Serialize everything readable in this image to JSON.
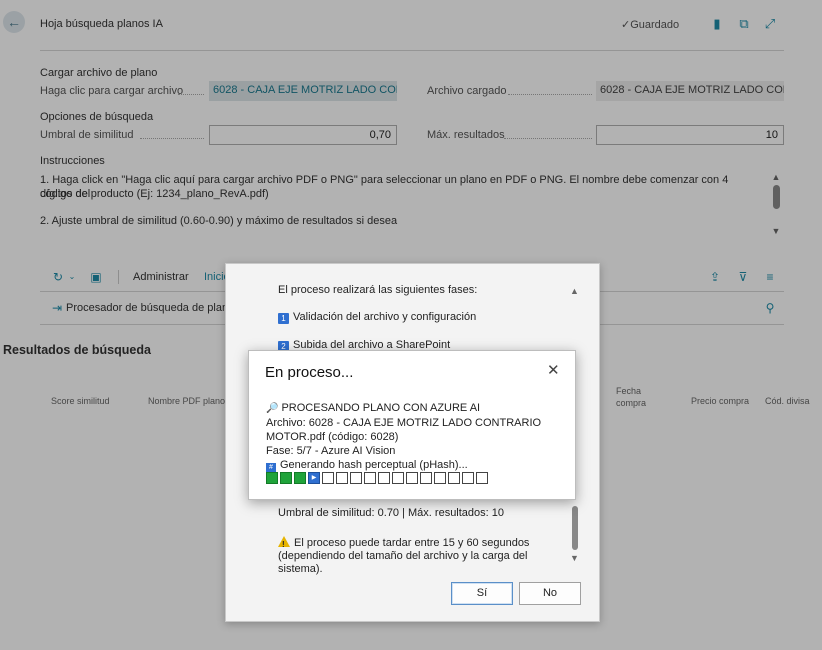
{
  "header": {
    "title": "Hoja búsqueda planos IA",
    "saved": "Guardado"
  },
  "upload": {
    "section": "Cargar archivo de plano",
    "click_label": "Haga clic para cargar archivo",
    "click_value": "6028 - CAJA EJE MOTRIZ LADO CON...",
    "loaded_label": "Archivo cargado",
    "loaded_value": "6028 - CAJA EJE MOTRIZ LADO CON..."
  },
  "options": {
    "section": "Opciones de búsqueda",
    "threshold_label": "Umbral de similitud",
    "threshold_value": "0,70",
    "max_label": "Máx. resultados",
    "max_value": "10"
  },
  "instructions": {
    "section": "Instrucciones",
    "line1": "1. Haga click en \"Haga clic aquí para cargar archivo PDF o PNG\" para seleccionar un plano en PDF o PNG. El nombre debe comenzar con 4 dígitos del",
    "line2": "código de producto (Ej: 1234_plano_RevA.pdf)",
    "line3": "2. Ajuste umbral de similitud (0.60-0.90) y máximo de resultados si desea"
  },
  "actionbar": {
    "administrar": "Administrar",
    "inicio": "Inicio",
    "processor": "Procesador de búsqueda de plano"
  },
  "results": {
    "title": "Resultados de búsqueda",
    "col_score": "Score similitud",
    "col_pdf": "Nombre PDF plano",
    "col_fecha": "Fecha",
    "col_compra": "compra",
    "col_precio": "Precio compra",
    "col_divisa": "Cód. divisa"
  },
  "confirm_dialog": {
    "intro": "El proceso realizará las siguientes fases:",
    "step1_num": "1",
    "step1": "Validación del archivo y configuración",
    "step2_num": "2",
    "step2": "Subida del archivo a SharePoint",
    "params": "Umbral de similitud: 0.70 | Máx. resultados: 10",
    "warn1": "El proceso puede tardar entre 15 y 60 segundos",
    "warn2": "(dependiendo del tamaño del archivo y la carga del sistema).",
    "yes": "Sí",
    "no": "No"
  },
  "progress_dialog": {
    "title": "En proceso...",
    "close": "✕",
    "line1": "PROCESANDO PLANO CON AZURE AI",
    "line2": "Archivo: 6028 - CAJA EJE MOTRIZ LADO CONTRARIO",
    "line3": "MOTOR.pdf (código: 6028)",
    "line4": "Fase: 5/7 - Azure AI Vision",
    "line5": "Generando hash perceptual (pHash)...",
    "progress_done": 4,
    "progress_total": 16
  },
  "colors": {
    "accent": "#1e8ca8",
    "progress_done": "#1fa33a",
    "step_badge": "#2f6fd0"
  }
}
